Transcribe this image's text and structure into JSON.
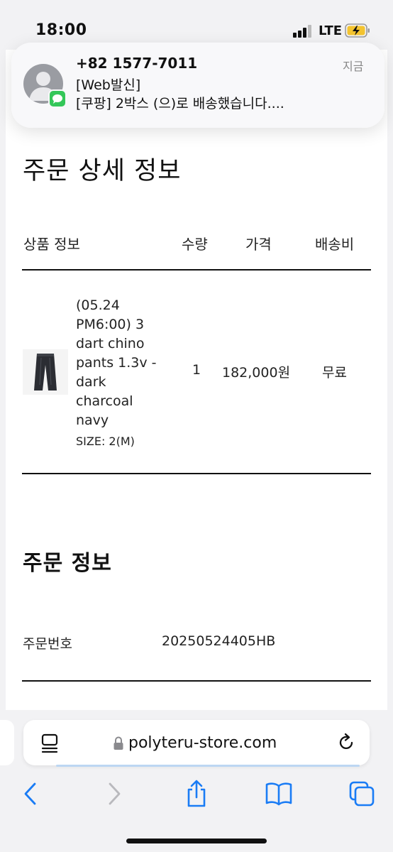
{
  "status_bar": {
    "time": "18:00",
    "network": "LTE"
  },
  "notification": {
    "sender": "+82 1577-7011",
    "line1": "[Web발신]",
    "line2": "[쿠팡] 2박스 (으)로 배송했습니다....",
    "time": "지금",
    "app_icon": "messages-icon"
  },
  "order_detail": {
    "title": "주문 상세 정보",
    "headers": {
      "product": "상품 정보",
      "qty": "수량",
      "price": "가격",
      "shipping": "배송비"
    },
    "item": {
      "name_lines": [
        "(05.24",
        "PM6:00) 3",
        "dart chino",
        "pants 1.3v -",
        "dark",
        "charcoal",
        "navy"
      ],
      "size": "SIZE: 2(M)",
      "qty": "1",
      "price": "182,000원",
      "shipping": "무료"
    }
  },
  "order_info": {
    "title": "주문 정보",
    "order_number_label": "주문번호",
    "order_number": "20250524405HB"
  },
  "browser": {
    "url": "polyteru-store.com",
    "icons": [
      "reader-icon",
      "lock-icon",
      "reload-icon",
      "back-icon",
      "forward-icon",
      "share-icon",
      "bookmarks-icon",
      "tabs-icon"
    ]
  },
  "colors": {
    "accent": "#1a7cf5",
    "badge": "#34c759",
    "background": "#f2f2f4"
  }
}
